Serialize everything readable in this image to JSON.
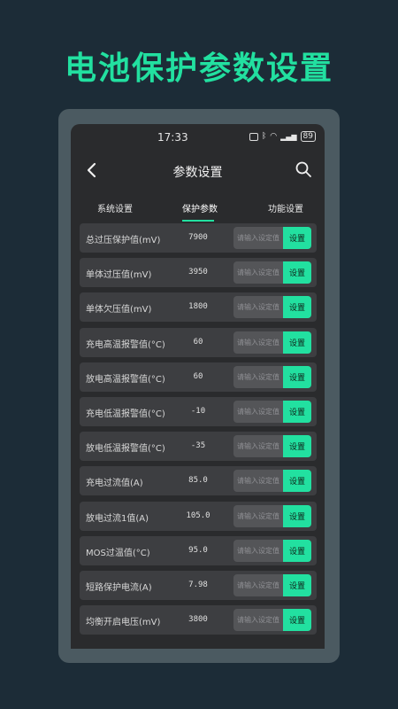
{
  "headline": "电池保护参数设置",
  "status_bar": {
    "time": "17:33",
    "battery": "89"
  },
  "nav": {
    "title": "参数设置"
  },
  "tabs": [
    {
      "label": "系统设置"
    },
    {
      "label": "保护参数"
    },
    {
      "label": "功能设置"
    }
  ],
  "active_tab_index": 1,
  "colors": {
    "accent": "#22e0a0",
    "background": "#1c2c37",
    "screen": "#2a2b2d",
    "row": "#3d3e41"
  },
  "placeholder": "请输入设定值",
  "set_label": "设置",
  "rows": [
    {
      "label": "总过压保护值(mV)",
      "value": "7900"
    },
    {
      "label": "单体过压值(mV)",
      "value": "3950"
    },
    {
      "label": "单体欠压值(mV)",
      "value": "1800"
    },
    {
      "label": "充电高温报警值(°C)",
      "value": "60"
    },
    {
      "label": "放电高温报警值(°C)",
      "value": "60"
    },
    {
      "label": "充电低温报警值(°C)",
      "value": "-10"
    },
    {
      "label": "放电低温报警值(°C)",
      "value": "-35"
    },
    {
      "label": "充电过流值(A)",
      "value": "85.0"
    },
    {
      "label": "放电过流1值(A)",
      "value": "105.0"
    },
    {
      "label": "MOS过温值(°C)",
      "value": "95.0"
    },
    {
      "label": "短路保护电流(A)",
      "value": "7.98"
    },
    {
      "label": "均衡开启电压(mV)",
      "value": "3800"
    }
  ]
}
